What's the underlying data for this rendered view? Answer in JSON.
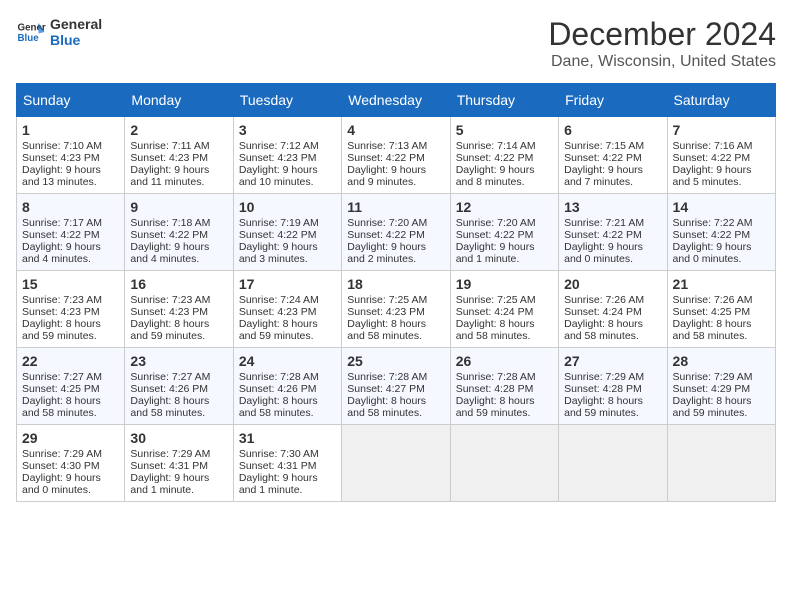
{
  "header": {
    "logo_line1": "General",
    "logo_line2": "Blue",
    "title": "December 2024",
    "subtitle": "Dane, Wisconsin, United States"
  },
  "weekdays": [
    "Sunday",
    "Monday",
    "Tuesday",
    "Wednesday",
    "Thursday",
    "Friday",
    "Saturday"
  ],
  "weeks": [
    [
      {
        "day": "1",
        "lines": [
          "Sunrise: 7:10 AM",
          "Sunset: 4:23 PM",
          "Daylight: 9 hours",
          "and 13 minutes."
        ]
      },
      {
        "day": "2",
        "lines": [
          "Sunrise: 7:11 AM",
          "Sunset: 4:23 PM",
          "Daylight: 9 hours",
          "and 11 minutes."
        ]
      },
      {
        "day": "3",
        "lines": [
          "Sunrise: 7:12 AM",
          "Sunset: 4:23 PM",
          "Daylight: 9 hours",
          "and 10 minutes."
        ]
      },
      {
        "day": "4",
        "lines": [
          "Sunrise: 7:13 AM",
          "Sunset: 4:22 PM",
          "Daylight: 9 hours",
          "and 9 minutes."
        ]
      },
      {
        "day": "5",
        "lines": [
          "Sunrise: 7:14 AM",
          "Sunset: 4:22 PM",
          "Daylight: 9 hours",
          "and 8 minutes."
        ]
      },
      {
        "day": "6",
        "lines": [
          "Sunrise: 7:15 AM",
          "Sunset: 4:22 PM",
          "Daylight: 9 hours",
          "and 7 minutes."
        ]
      },
      {
        "day": "7",
        "lines": [
          "Sunrise: 7:16 AM",
          "Sunset: 4:22 PM",
          "Daylight: 9 hours",
          "and 5 minutes."
        ]
      }
    ],
    [
      {
        "day": "8",
        "lines": [
          "Sunrise: 7:17 AM",
          "Sunset: 4:22 PM",
          "Daylight: 9 hours",
          "and 4 minutes."
        ]
      },
      {
        "day": "9",
        "lines": [
          "Sunrise: 7:18 AM",
          "Sunset: 4:22 PM",
          "Daylight: 9 hours",
          "and 4 minutes."
        ]
      },
      {
        "day": "10",
        "lines": [
          "Sunrise: 7:19 AM",
          "Sunset: 4:22 PM",
          "Daylight: 9 hours",
          "and 3 minutes."
        ]
      },
      {
        "day": "11",
        "lines": [
          "Sunrise: 7:20 AM",
          "Sunset: 4:22 PM",
          "Daylight: 9 hours",
          "and 2 minutes."
        ]
      },
      {
        "day": "12",
        "lines": [
          "Sunrise: 7:20 AM",
          "Sunset: 4:22 PM",
          "Daylight: 9 hours",
          "and 1 minute."
        ]
      },
      {
        "day": "13",
        "lines": [
          "Sunrise: 7:21 AM",
          "Sunset: 4:22 PM",
          "Daylight: 9 hours",
          "and 0 minutes."
        ]
      },
      {
        "day": "14",
        "lines": [
          "Sunrise: 7:22 AM",
          "Sunset: 4:22 PM",
          "Daylight: 9 hours",
          "and 0 minutes."
        ]
      }
    ],
    [
      {
        "day": "15",
        "lines": [
          "Sunrise: 7:23 AM",
          "Sunset: 4:23 PM",
          "Daylight: 8 hours",
          "and 59 minutes."
        ]
      },
      {
        "day": "16",
        "lines": [
          "Sunrise: 7:23 AM",
          "Sunset: 4:23 PM",
          "Daylight: 8 hours",
          "and 59 minutes."
        ]
      },
      {
        "day": "17",
        "lines": [
          "Sunrise: 7:24 AM",
          "Sunset: 4:23 PM",
          "Daylight: 8 hours",
          "and 59 minutes."
        ]
      },
      {
        "day": "18",
        "lines": [
          "Sunrise: 7:25 AM",
          "Sunset: 4:23 PM",
          "Daylight: 8 hours",
          "and 58 minutes."
        ]
      },
      {
        "day": "19",
        "lines": [
          "Sunrise: 7:25 AM",
          "Sunset: 4:24 PM",
          "Daylight: 8 hours",
          "and 58 minutes."
        ]
      },
      {
        "day": "20",
        "lines": [
          "Sunrise: 7:26 AM",
          "Sunset: 4:24 PM",
          "Daylight: 8 hours",
          "and 58 minutes."
        ]
      },
      {
        "day": "21",
        "lines": [
          "Sunrise: 7:26 AM",
          "Sunset: 4:25 PM",
          "Daylight: 8 hours",
          "and 58 minutes."
        ]
      }
    ],
    [
      {
        "day": "22",
        "lines": [
          "Sunrise: 7:27 AM",
          "Sunset: 4:25 PM",
          "Daylight: 8 hours",
          "and 58 minutes."
        ]
      },
      {
        "day": "23",
        "lines": [
          "Sunrise: 7:27 AM",
          "Sunset: 4:26 PM",
          "Daylight: 8 hours",
          "and 58 minutes."
        ]
      },
      {
        "day": "24",
        "lines": [
          "Sunrise: 7:28 AM",
          "Sunset: 4:26 PM",
          "Daylight: 8 hours",
          "and 58 minutes."
        ]
      },
      {
        "day": "25",
        "lines": [
          "Sunrise: 7:28 AM",
          "Sunset: 4:27 PM",
          "Daylight: 8 hours",
          "and 58 minutes."
        ]
      },
      {
        "day": "26",
        "lines": [
          "Sunrise: 7:28 AM",
          "Sunset: 4:28 PM",
          "Daylight: 8 hours",
          "and 59 minutes."
        ]
      },
      {
        "day": "27",
        "lines": [
          "Sunrise: 7:29 AM",
          "Sunset: 4:28 PM",
          "Daylight: 8 hours",
          "and 59 minutes."
        ]
      },
      {
        "day": "28",
        "lines": [
          "Sunrise: 7:29 AM",
          "Sunset: 4:29 PM",
          "Daylight: 8 hours",
          "and 59 minutes."
        ]
      }
    ],
    [
      {
        "day": "29",
        "lines": [
          "Sunrise: 7:29 AM",
          "Sunset: 4:30 PM",
          "Daylight: 9 hours",
          "and 0 minutes."
        ]
      },
      {
        "day": "30",
        "lines": [
          "Sunrise: 7:29 AM",
          "Sunset: 4:31 PM",
          "Daylight: 9 hours",
          "and 1 minute."
        ]
      },
      {
        "day": "31",
        "lines": [
          "Sunrise: 7:30 AM",
          "Sunset: 4:31 PM",
          "Daylight: 9 hours",
          "and 1 minute."
        ]
      },
      null,
      null,
      null,
      null
    ]
  ]
}
